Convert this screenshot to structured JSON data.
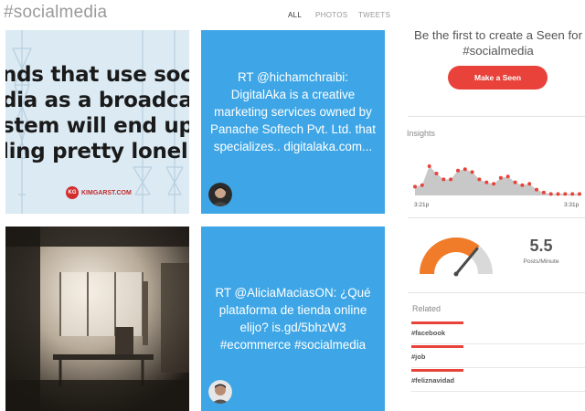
{
  "page": {
    "hashtag": "#socialmedia"
  },
  "filters": [
    {
      "label": "ALL",
      "active": true
    },
    {
      "label": "PHOTOS",
      "active": false
    },
    {
      "label": "TWEETS",
      "active": false
    }
  ],
  "tiles": {
    "image_quote": {
      "lines": [
        "nds that use soci",
        "dia as a broadca",
        "stem will end up",
        "ling pretty lonel"
      ],
      "logo_text": "KIMGARST.COM"
    },
    "tweet1": {
      "text": "RT @hichamchraibi: DigitalAka is a creative marketing services owned by Panache Softech Pvt. Ltd. that specializes.. digitalaka.com..."
    },
    "tweet2": {
      "text": "RT @AliciaMaciasON: ¿Qué plataforma de tienda online elijo? is.gd/5bhzW3 #ecommerce #socialmedia"
    }
  },
  "sidebar": {
    "seen_prompt": "Be the first to create a Seen for #socialmedia",
    "make_seen_label": "Make a Seen",
    "insights_label": "Insights",
    "time_start": "3:21p",
    "time_end": "3:31p",
    "rate_value": "5.5",
    "rate_unit": "Posts/Minute",
    "gauge_level": 0.72,
    "related_label": "Related",
    "related": [
      "#facebook",
      "#job",
      "#feliznavidad"
    ]
  },
  "colors": {
    "accent": "#e8423a",
    "tweet_bg": "#3ea6e6",
    "gauge": "#f07c2a"
  },
  "sparkline_values": [
    0.3,
    0.35,
    1.0,
    0.75,
    0.55,
    0.55,
    0.85,
    0.9,
    0.8,
    0.55,
    0.45,
    0.4,
    0.6,
    0.65,
    0.45,
    0.35,
    0.4,
    0.2,
    0.1,
    0.05,
    0.05,
    0.05,
    0.05,
    0.05
  ]
}
